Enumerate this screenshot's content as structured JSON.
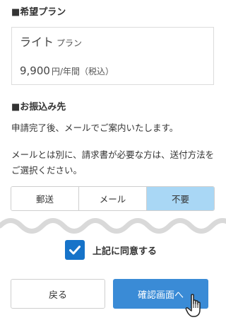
{
  "plan_section": {
    "title": "■希望プラン",
    "plan_name": "ライト",
    "plan_suffix": "プラン",
    "price": "9,900",
    "price_unit": "円/年間（税込）"
  },
  "transfer_section": {
    "title": "■お振込み先",
    "line1": "申請完了後、メールでご案内いたします。",
    "line2": "メールとは別に、請求書が必要な方は、送付方法をご選択ください。",
    "options": [
      "郵送",
      "メール",
      "不要"
    ],
    "selected": "不要"
  },
  "agreement": {
    "label": "上記に同意する",
    "checked": true
  },
  "buttons": {
    "back": "戻る",
    "confirm": "確認画面へ"
  },
  "colors": {
    "selected_option": "#a9d7f5",
    "checkbox": "#1673c9",
    "confirm_button": "#3a8bd6",
    "wave": "#d9d9d9"
  },
  "icons": {
    "checkbox": "checkmark-icon",
    "cursor": "hand-pointer-icon"
  }
}
